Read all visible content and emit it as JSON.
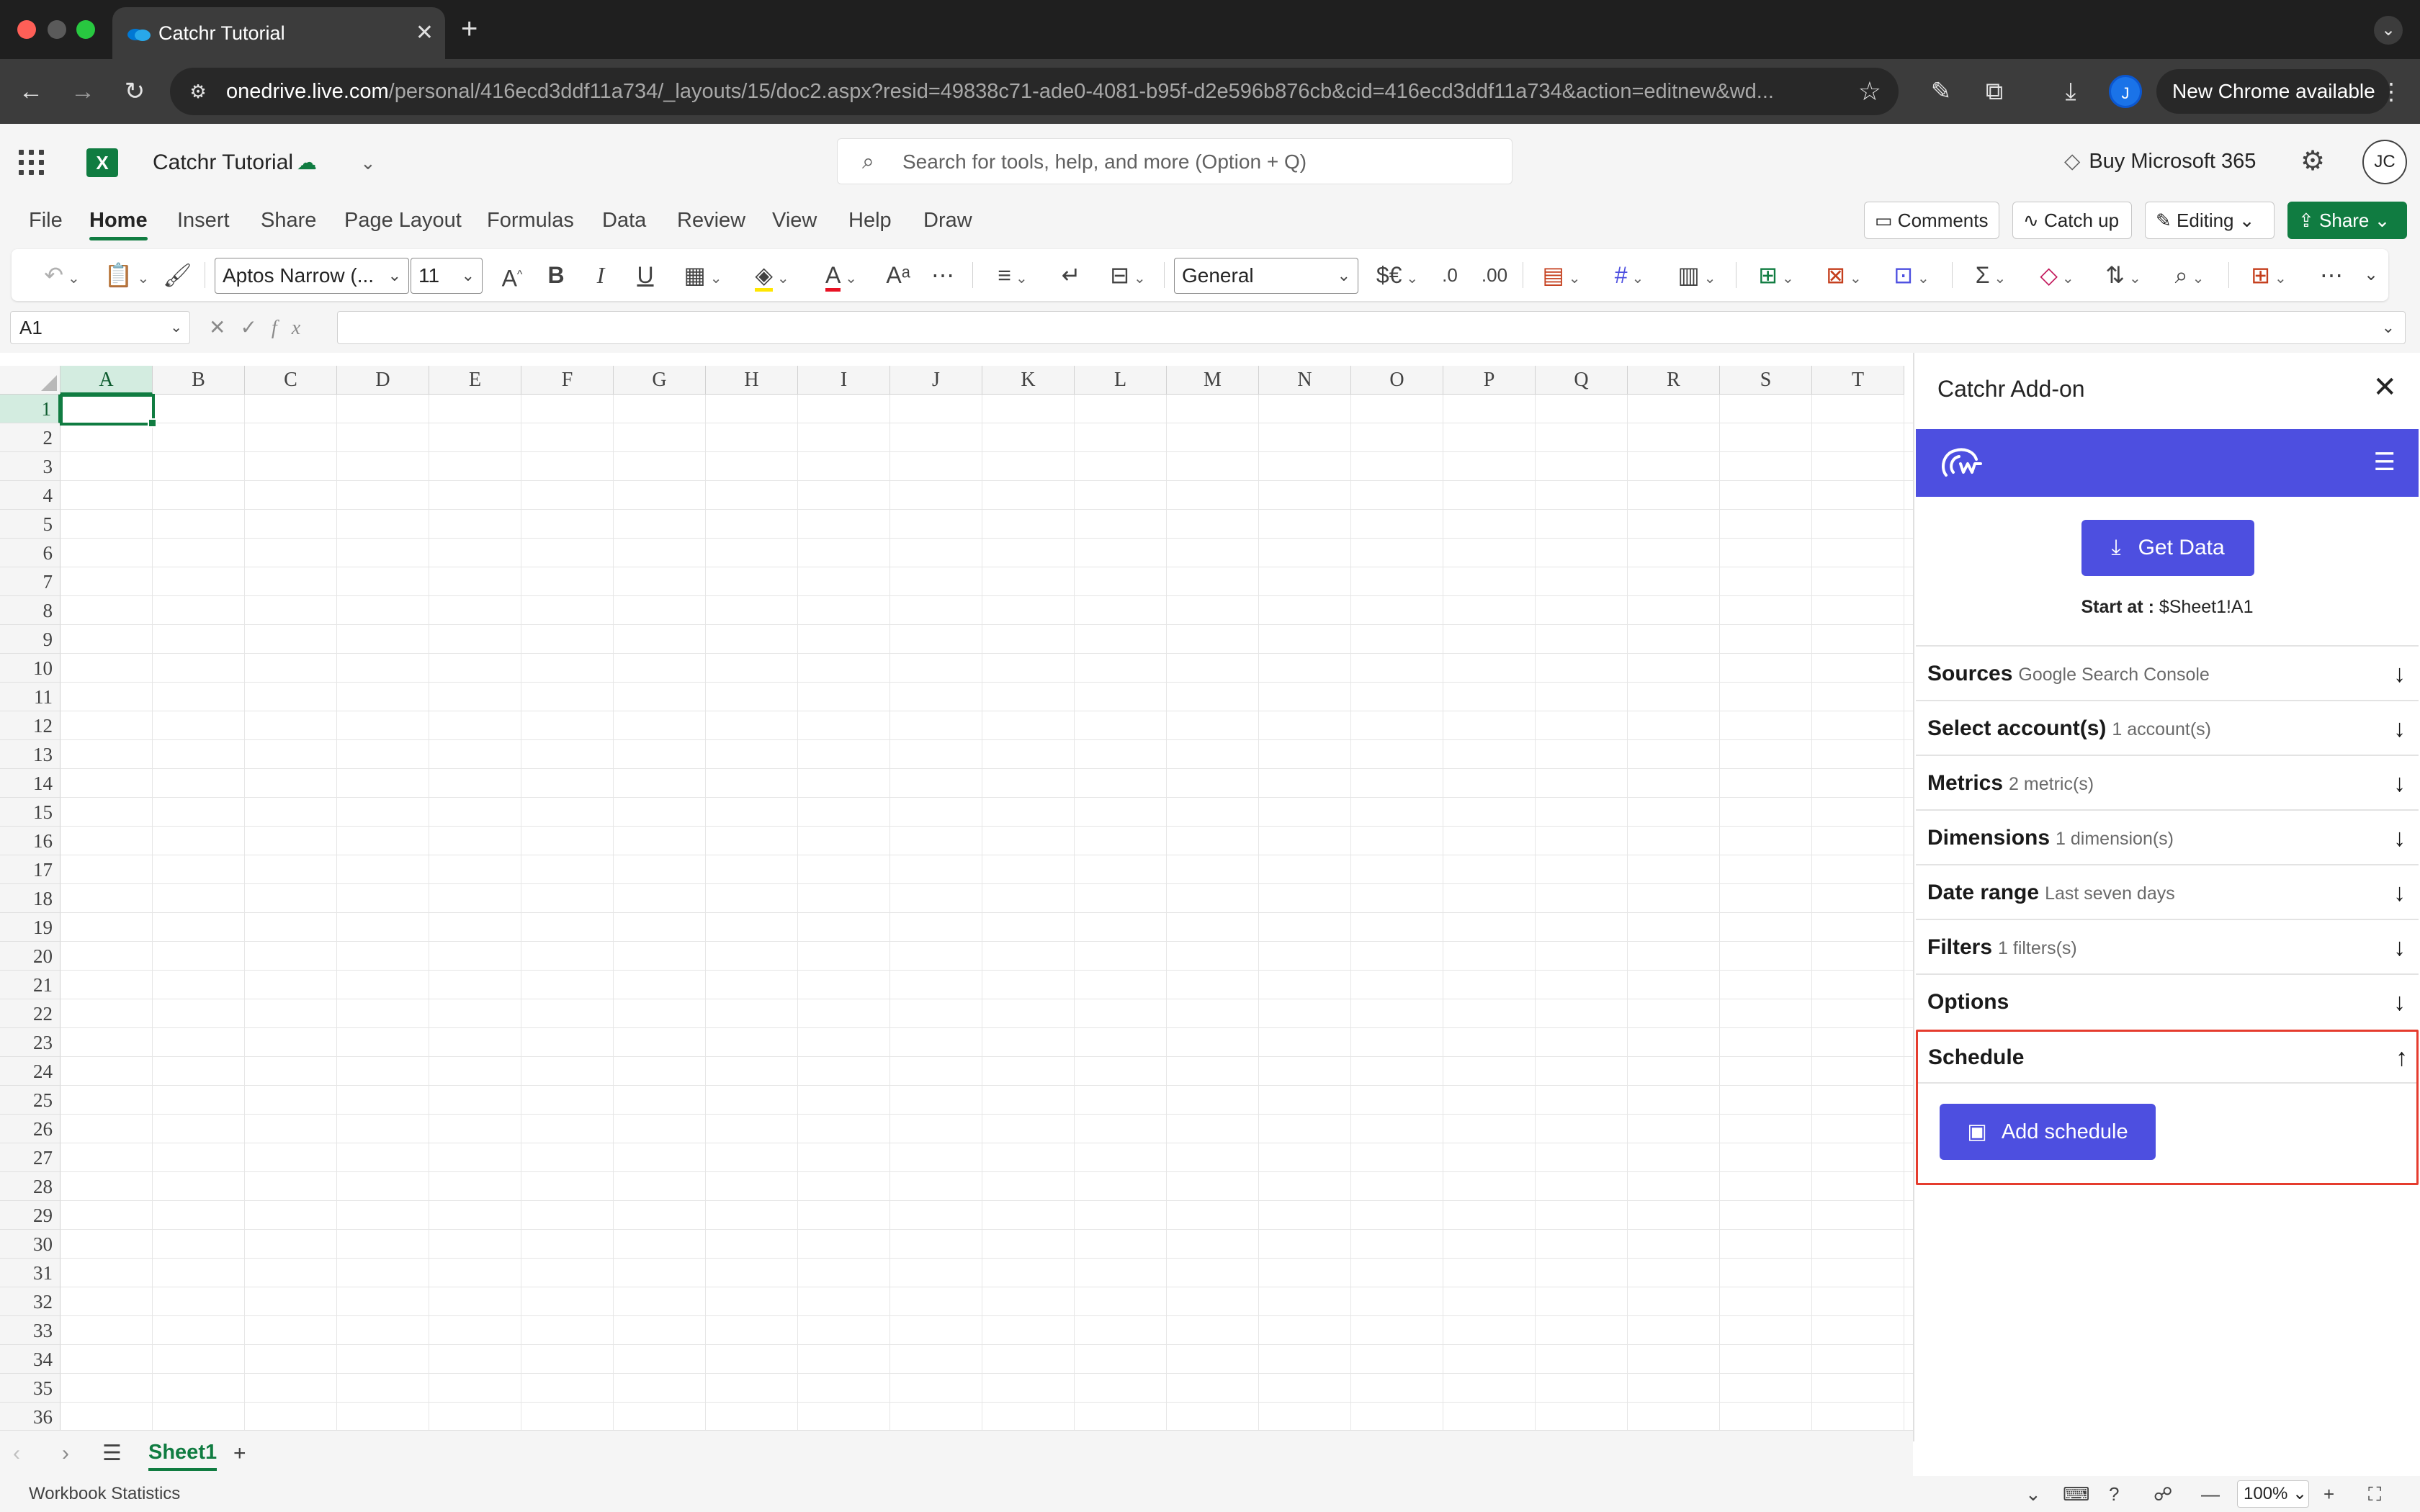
{
  "browser": {
    "tab_title": "Catchr Tutorial",
    "url_host": "onedrive.live.com",
    "url_path": "/personal/416ecd3ddf11a734/_layouts/15/doc2.aspx?resid=49838c71-ade0-4081-b95f-d2e596b876cb&cid=416ecd3ddf11a734&action=editnew&wd...",
    "profile_initial": "J",
    "update_chip": "New Chrome available"
  },
  "excel": {
    "doc_title": "Catchr Tutorial",
    "search_placeholder": "Search for tools, help, and more (Option + Q)",
    "buy_label": "Buy Microsoft 365",
    "avatar_initials": "JC",
    "ribbon_tabs": [
      "File",
      "Home",
      "Insert",
      "Share",
      "Page Layout",
      "Formulas",
      "Data",
      "Review",
      "View",
      "Help",
      "Draw"
    ],
    "active_tab": "Home",
    "comments_label": "Comments",
    "catchup_label": "Catch up",
    "editing_label": "Editing",
    "share_label": "Share",
    "font_name": "Aptos Narrow (...",
    "font_size": "11",
    "number_format": "General",
    "currency_symbol": "$€",
    "name_box": "A1",
    "columns": [
      "A",
      "B",
      "C",
      "D",
      "E",
      "F",
      "G",
      "H",
      "I",
      "J",
      "K",
      "L",
      "M",
      "N",
      "O",
      "P",
      "Q",
      "R",
      "S",
      "T"
    ],
    "rows": [
      "1",
      "2",
      "3",
      "4",
      "5",
      "6",
      "7",
      "8",
      "9",
      "10",
      "11",
      "12",
      "13",
      "14",
      "15",
      "16",
      "17",
      "18",
      "19",
      "20",
      "21",
      "22",
      "23",
      "24",
      "25",
      "26",
      "27",
      "28",
      "29",
      "30",
      "31",
      "32",
      "33",
      "34",
      "35",
      "36"
    ],
    "selected_cell": "A1",
    "sheet_tab": "Sheet1",
    "status_text": "Workbook Statistics",
    "zoom": "100%"
  },
  "addon": {
    "title": "Catchr Add-on",
    "get_data_label": "Get Data",
    "start_at_label": "Start at :",
    "start_at_value": "$Sheet1!A1",
    "sections": [
      {
        "label": "Sources",
        "sub": "Google Search Console"
      },
      {
        "label": "Select account(s)",
        "sub": "1 account(s)"
      },
      {
        "label": "Metrics",
        "sub": "2 metric(s)"
      },
      {
        "label": "Dimensions",
        "sub": "1 dimension(s)"
      },
      {
        "label": "Date range",
        "sub": "Last seven days"
      },
      {
        "label": "Filters",
        "sub": "1 filters(s)"
      },
      {
        "label": "Options",
        "sub": ""
      }
    ],
    "schedule_label": "Schedule",
    "add_schedule_label": "Add schedule",
    "colors": {
      "accent": "#4d4fe0",
      "highlight": "#e53c2e",
      "excel_green": "#107c41"
    }
  }
}
